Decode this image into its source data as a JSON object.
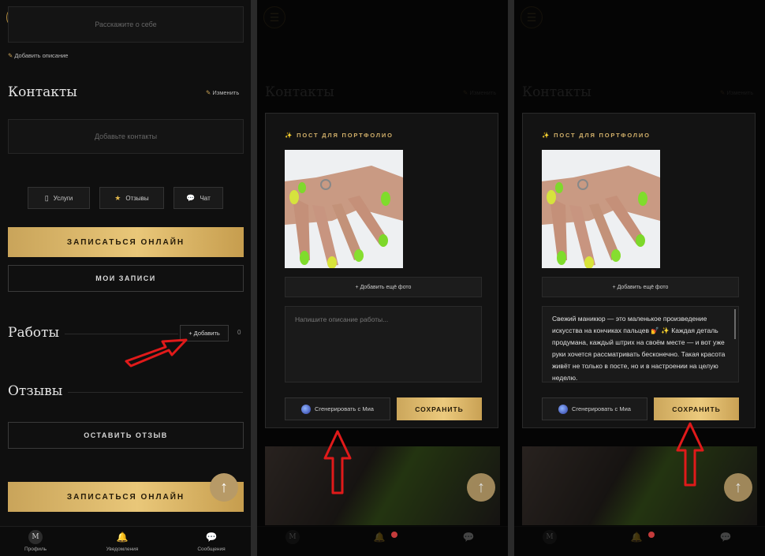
{
  "profile": {
    "about_placeholder": "Расскажите о себе",
    "add_description": "Добавить описание",
    "contacts_title": "Контакты",
    "edit_label": "Изменить",
    "contacts_placeholder": "Добавьте контакты",
    "tabs": [
      {
        "label": "Услуги",
        "icon": "document-icon"
      },
      {
        "label": "Отзывы",
        "icon": "star-icon"
      },
      {
        "label": "Чат",
        "icon": "chat-bubble-icon"
      }
    ],
    "book_online": "ЗАПИСАТЬСЯ ОНЛАЙН",
    "my_bookings": "МОИ ЗАПИСИ",
    "works_title": "Работы",
    "add_work": "+ Добавить",
    "works_count": "0",
    "reviews_title": "Отзывы",
    "leave_review": "ОСТАВИТЬ ОТЗЫВ",
    "book_online_bottom": "ЗАПИСАТЬСЯ ОНЛАЙН"
  },
  "nav": {
    "items": [
      {
        "label": "Профиль",
        "icon": "avatar-m-icon",
        "avatar_letter": "M"
      },
      {
        "label": "Уведомления",
        "icon": "bell-icon"
      },
      {
        "label": "Сообщения",
        "icon": "chat-bubble-icon"
      }
    ]
  },
  "modal": {
    "title": "ПОСТ ДЛЯ ПОРТФОЛИО",
    "add_more_photo": "+ Добавить ещё фото",
    "description_placeholder": "Напишите описание работы...",
    "generated_text": "Свежий маникюр — это маленькое произведение искусства на кончиках пальцев 💅 ✨ Каждая деталь продумана, каждый штрих на своём месте — и вот уже руки хочется рассматривать бесконечно. Такая красота живёт не только в посте, но и в настроении на целую неделю.",
    "generate_button": "Сгенерировать с Миа",
    "save_button": "СОХРАНИТЬ"
  },
  "colors": {
    "accent_gold": "#d6b55d",
    "background": "#0f0f0f",
    "arrow_red": "#e01a1a"
  }
}
